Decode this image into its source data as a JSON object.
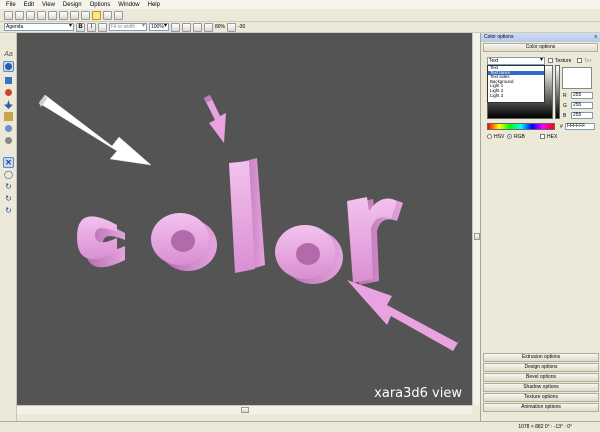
{
  "menu": [
    "File",
    "Edit",
    "View",
    "Design",
    "Options",
    "Window",
    "Help"
  ],
  "toolbar2": {
    "font_name": "Agenda",
    "bold": "B",
    "italic": "I",
    "fit_mode": "Fit to width",
    "zoom": "100%",
    "percent": "80%",
    "angle": "-30"
  },
  "left_tools": [
    "Aa"
  ],
  "canvas": {
    "background": "#545454",
    "text": "color",
    "text_color": "#e8a3e0",
    "watermark": "xara3d6 view"
  },
  "panel": {
    "title": "Color options",
    "close": "x",
    "section": "Color options",
    "selected": "Text",
    "items": [
      "Text",
      "Text faces",
      "Text sides",
      "Background",
      "Light 1",
      "Light 2",
      "Light 3"
    ],
    "highlighted_index": 1,
    "texture_label": "Texture",
    "tex_label": "Tex",
    "r_label": "R",
    "g_label": "G",
    "b_label": "B",
    "r": "255",
    "g": "255",
    "b": "255",
    "hash": "#",
    "hex": "FFFFFF",
    "hsv_label": "HSV",
    "rgb_label": "RGB",
    "hex_label": "HEX"
  },
  "sections": [
    "Extrusion options",
    "Design options",
    "Bevel options",
    "Shadow options",
    "Texture options",
    "Animation options"
  ],
  "status": {
    "dims": "1078 × 882",
    "angles": "0° : -13° : 0°"
  }
}
